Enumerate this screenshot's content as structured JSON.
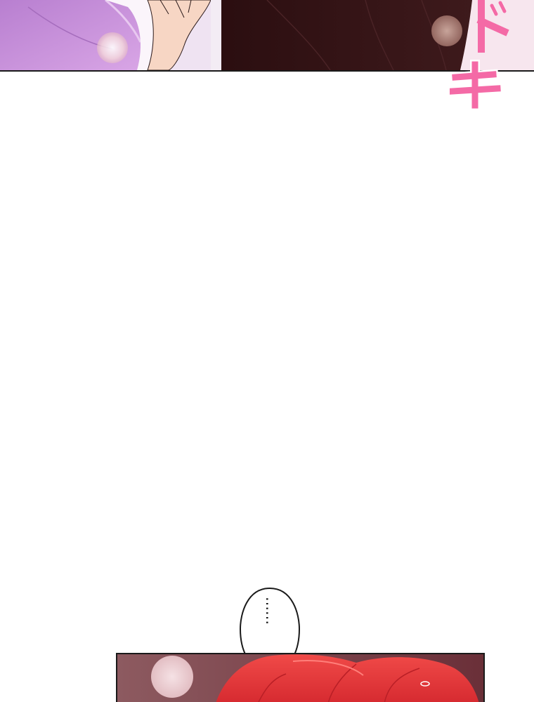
{
  "top_panel": {
    "colors": {
      "sleeve": "#c58fd6",
      "hair": "#2a0f10",
      "skin": "#f7d6c4",
      "pink_sfx": "#f46aa6"
    }
  },
  "sfx": {
    "text": "ドキ"
  },
  "speech_bubble": {
    "text": "……"
  },
  "bottom_panel": {
    "colors": {
      "background": "#7a3a44",
      "hair": "#e2363c"
    }
  }
}
